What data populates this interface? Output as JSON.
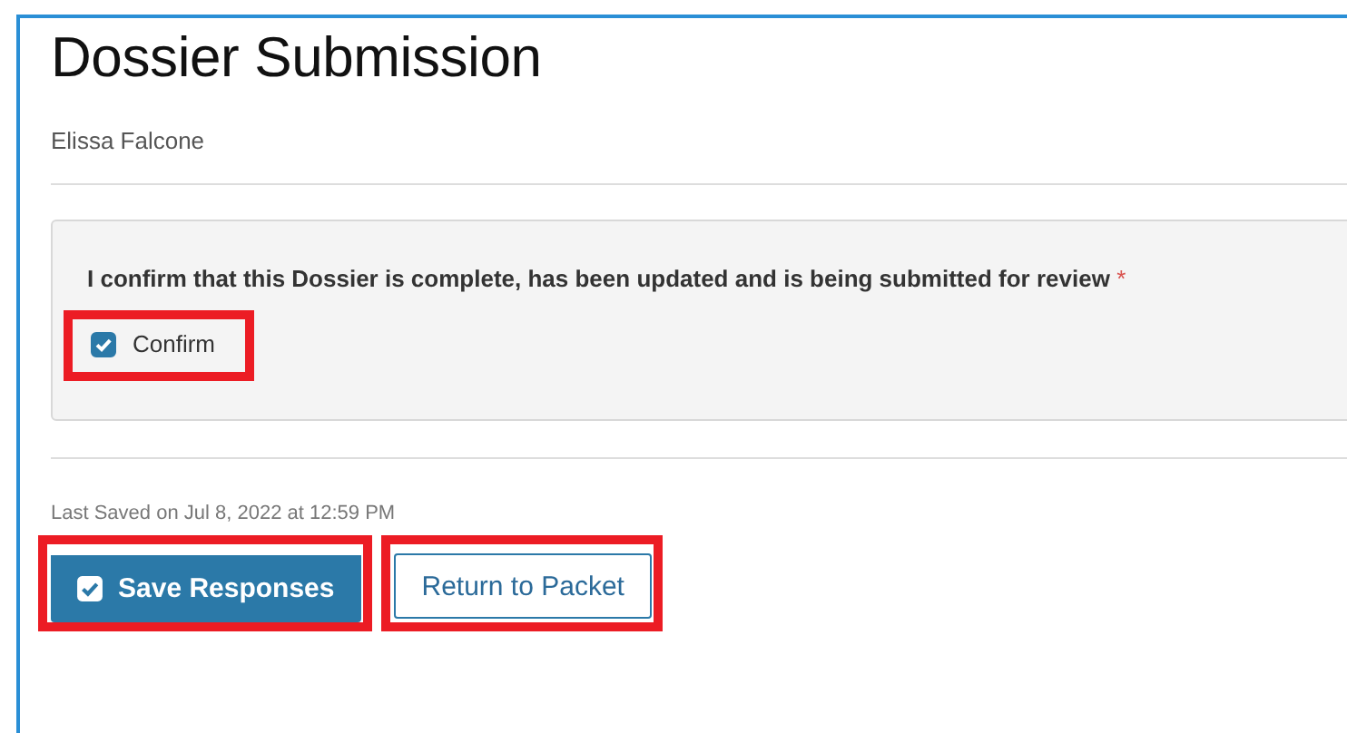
{
  "page": {
    "title": "Dossier Submission",
    "subtitle": "Elissa Falcone"
  },
  "question": {
    "text": "I confirm that this Dossier is complete, has been updated and is being submitted for review",
    "required_mark": "*",
    "option": {
      "label": "Confirm",
      "checked": true,
      "highlighted": true
    }
  },
  "last_saved": "Last Saved on Jul 8, 2022 at 12:59 PM",
  "buttons": [
    {
      "label": "Save Responses",
      "kind": "primary",
      "highlighted": true
    },
    {
      "label": "Return to Packet",
      "kind": "secondary",
      "highlighted": true
    }
  ]
}
